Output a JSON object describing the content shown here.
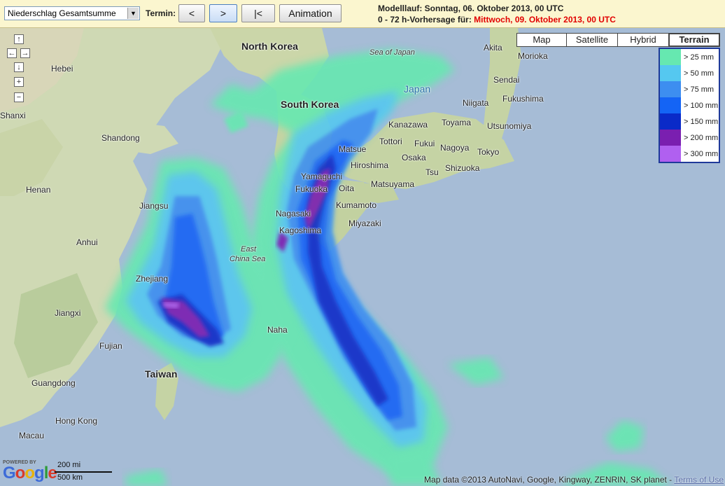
{
  "toolbar": {
    "select_value": "Niederschlag Gesamtsumme",
    "termin_label": "Termin:",
    "prev_label": "<",
    "next_label": ">",
    "first_label": "|<",
    "animation_label": "Animation",
    "model_run_label": "Modelllauf: Sonntag, 06. Oktober 2013, 00 UTC",
    "forecast_label": "0 - 72 h-Vorhersage für:",
    "forecast_value": "Mittwoch, 09. Oktober 2013, 00 UTC",
    "colors": {
      "background": "#fbf6cf",
      "forecast_value": "#e20000"
    }
  },
  "map_types": [
    {
      "label": "Map",
      "selected": false
    },
    {
      "label": "Satellite",
      "selected": false
    },
    {
      "label": "Hybrid",
      "selected": false
    },
    {
      "label": "Terrain",
      "selected": true
    }
  ],
  "nav": {
    "up": "↑",
    "left": "←",
    "right": "→",
    "down": "↓",
    "zoom_in": "+",
    "zoom_out": "−"
  },
  "legend": [
    {
      "label": "> 25 mm",
      "color": "#66e8b0"
    },
    {
      "label": "> 50 mm",
      "color": "#55c8f0"
    },
    {
      "label": "> 75 mm",
      "color": "#3d8ef0"
    },
    {
      "label": "> 100 mm",
      "color": "#1464f5"
    },
    {
      "label": "> 150 mm",
      "color": "#0a2ac8"
    },
    {
      "label": "> 200 mm",
      "color": "#7a1fb0"
    },
    {
      "label": "> 300 mm",
      "color": "#b060f0"
    }
  ],
  "places": {
    "north_korea": "North Korea",
    "south_korea": "South Korea",
    "japan": "Japan",
    "sea_of_japan": "Sea of Japan",
    "east_china_sea_1": "East",
    "east_china_sea_2": "China Sea",
    "hebei": "Hebei",
    "shanxi": "Shanxi",
    "shandong": "Shandong",
    "henan": "Henan",
    "jiangsu": "Jiangsu",
    "anhui": "Anhui",
    "zhejiang": "Zhejiang",
    "jiangxi": "Jiangxi",
    "fujian": "Fujian",
    "guangdong": "Guangdong",
    "taiwan": "Taiwan",
    "hong_kong": "Hong Kong",
    "macau": "Macau",
    "naha": "Naha",
    "akita": "Akita",
    "morioka": "Morioka",
    "sendai": "Sendai",
    "fukushima": "Fukushima",
    "niigata": "Niigata",
    "kanazawa": "Kanazawa",
    "toyama": "Toyama",
    "utsunomiya": "Utsunomiya",
    "tottori": "Tottori",
    "fukui": "Fukui",
    "nagoya": "Nagoya",
    "tokyo": "Tokyo",
    "matsue": "Matsue",
    "hiroshima": "Hiroshima",
    "osaka": "Osaka",
    "tsu": "Tsu",
    "shizuoka": "Shizuoka",
    "yamaguchi": "Yamaguchi",
    "fukuoka": "Fukuoka",
    "oita": "Oita",
    "matsuyama": "Matsuyama",
    "kumamoto": "Kumamoto",
    "nagasaki": "Nagasaki",
    "miyazaki": "Miyazaki",
    "kagoshima": "Kagoshima"
  },
  "footer": {
    "map_data": "Map data ©2013 AutoNavi, Google, Kingway, ZENRIN, SK planet -",
    "terms": "Terms of Use"
  },
  "logo": {
    "powered": "POWERED BY",
    "google": "Google"
  },
  "scale": {
    "miles": "200 mi",
    "km": "500 km"
  }
}
